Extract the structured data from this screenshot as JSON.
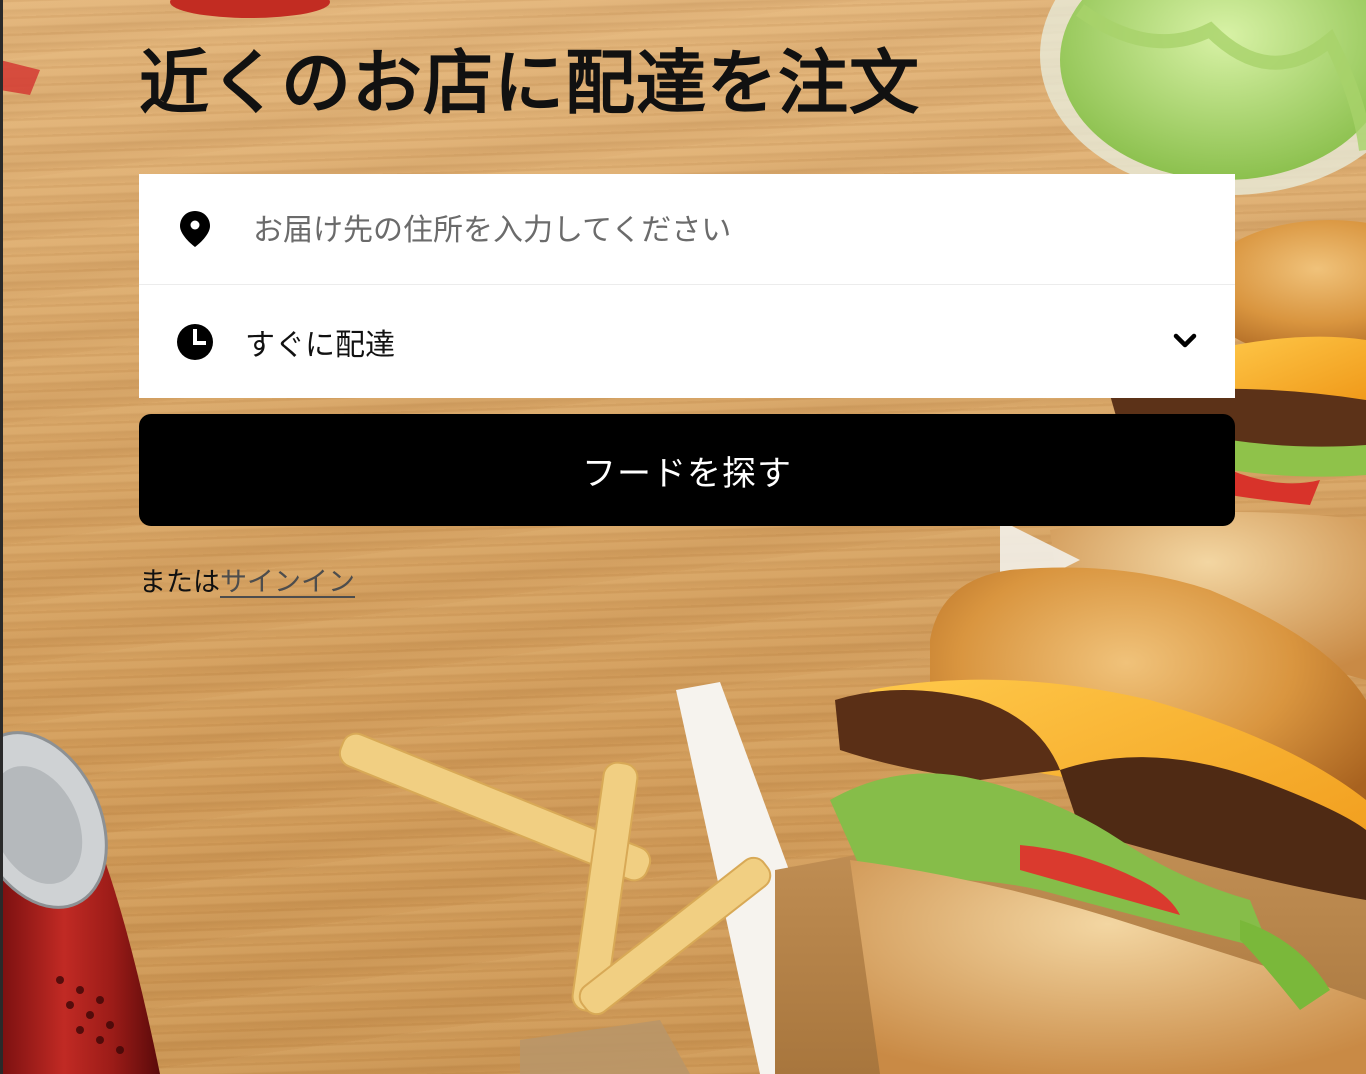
{
  "hero": {
    "headline": "近くのお店に配達を注文"
  },
  "address_field": {
    "placeholder": "お届け先の住所を入力してください",
    "value": "",
    "icon": "location-pin-icon"
  },
  "delivery_time": {
    "selected": "すぐに配達",
    "icon": "clock-icon",
    "dropdown_icon": "chevron-down-icon"
  },
  "find_button": {
    "label": "フードを探す"
  },
  "signin": {
    "prefix": "または",
    "link_label": "サインイン"
  },
  "colors": {
    "button_bg": "#000000",
    "button_text": "#ffffff",
    "card_bg": "#ffffff",
    "headline": "#111111",
    "table_wood": "#d7a465"
  }
}
